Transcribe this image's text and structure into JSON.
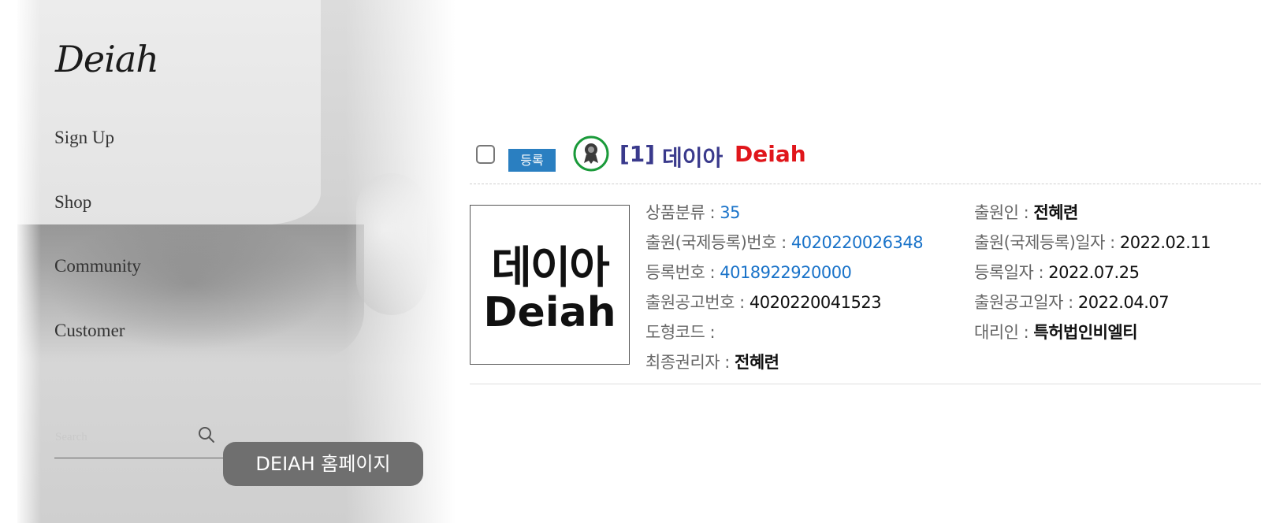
{
  "site": {
    "logo": "Deiah",
    "nav": [
      "Sign Up",
      "Shop",
      "Community",
      "Customer"
    ],
    "search_placeholder": "Search",
    "caption": "DEIAH 홈페이지"
  },
  "record": {
    "status_badge": "등록",
    "index": "[1]",
    "title_korean": "데이아",
    "title_english": "Deiah",
    "mark_text_korean": "데이아",
    "mark_text_english": "Deiah",
    "left_fields": [
      {
        "label": "상품분류 : ",
        "value": "35",
        "style": "link"
      },
      {
        "label": "출원(국제등록)번호 : ",
        "value": "4020220026348",
        "style": "link"
      },
      {
        "label": "등록번호 : ",
        "value": "4018922920000",
        "style": "link"
      },
      {
        "label": "출원공고번호 : ",
        "value": "4020220041523",
        "style": "v"
      },
      {
        "label": "도형코드 : ",
        "value": "",
        "style": "v"
      },
      {
        "label": "최종권리자 : ",
        "value": "전혜련",
        "style": "strong"
      }
    ],
    "right_fields": [
      {
        "label": "출원인 : ",
        "value": "전혜련",
        "style": "strong"
      },
      {
        "label": "출원(국제등록)일자 : ",
        "value": "2022.02.11",
        "style": "v"
      },
      {
        "label": "등록일자 : ",
        "value": "2022.07.25",
        "style": "v"
      },
      {
        "label": "출원공고일자 : ",
        "value": "2022.04.07",
        "style": "v"
      },
      {
        "label": "대리인 : ",
        "value": "특허법인비엘티",
        "style": "strong"
      }
    ]
  },
  "colors": {
    "status_badge": "#2a7fc1",
    "title_korean": "#3a3a8c",
    "title_english": "#e0161b",
    "link": "#1a73c9",
    "registered_icon": "#1a9a3a"
  },
  "icons": {
    "search": "magnifier-icon",
    "registered": "award-medal-icon"
  }
}
